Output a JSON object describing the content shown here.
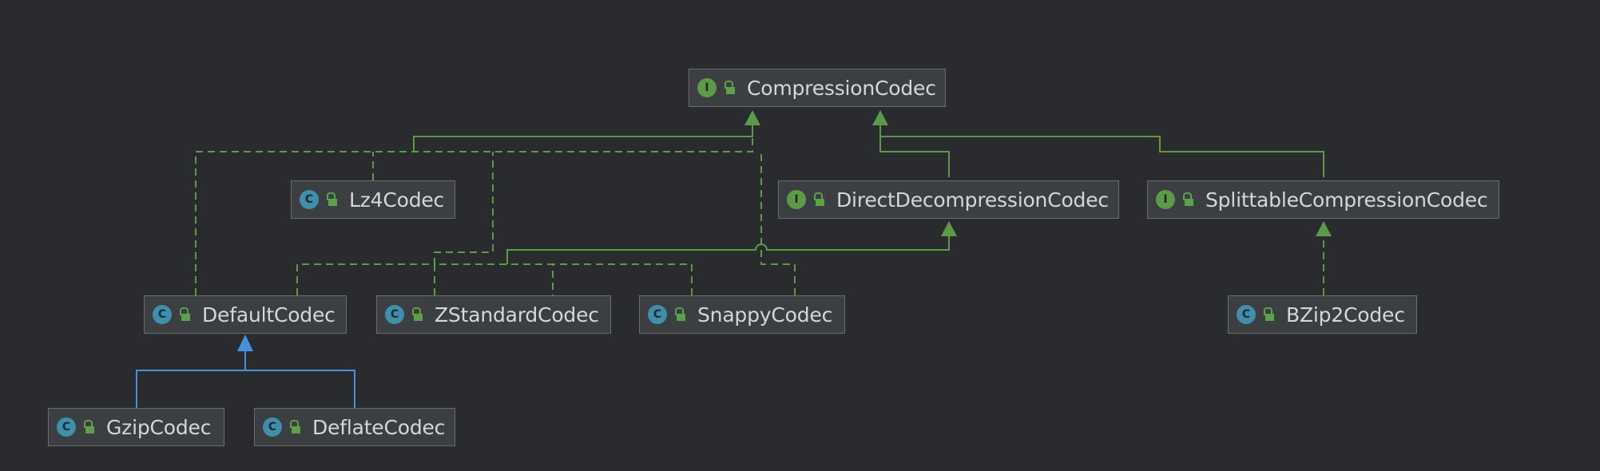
{
  "diagram": {
    "nodes": [
      {
        "id": "compression-codec",
        "kind": "I",
        "label": "CompressionCodec"
      },
      {
        "id": "lz4-codec",
        "kind": "C",
        "label": "Lz4Codec"
      },
      {
        "id": "direct-decompression-codec",
        "kind": "I",
        "label": "DirectDecompressionCodec"
      },
      {
        "id": "splittable-compression-codec",
        "kind": "I",
        "label": "SplittableCompressionCodec"
      },
      {
        "id": "default-codec",
        "kind": "C",
        "label": "DefaultCodec"
      },
      {
        "id": "zstandard-codec",
        "kind": "C",
        "label": "ZStandardCodec"
      },
      {
        "id": "snappy-codec",
        "kind": "C",
        "label": "SnappyCodec"
      },
      {
        "id": "bzip2-codec",
        "kind": "C",
        "label": "BZip2Codec"
      },
      {
        "id": "gzip-codec",
        "kind": "C",
        "label": "GzipCodec"
      },
      {
        "id": "deflate-codec",
        "kind": "C",
        "label": "DeflateCodec"
      }
    ],
    "edges": [
      {
        "from": "direct-decompression-codec",
        "to": "compression-codec",
        "type": "extends-interface"
      },
      {
        "from": "splittable-compression-codec",
        "to": "compression-codec",
        "type": "extends-interface"
      },
      {
        "from": "lz4-codec",
        "to": "compression-codec",
        "type": "implements"
      },
      {
        "from": "default-codec",
        "to": "compression-codec",
        "type": "implements"
      },
      {
        "from": "zstandard-codec",
        "to": "compression-codec",
        "type": "implements"
      },
      {
        "from": "snappy-codec",
        "to": "compression-codec",
        "type": "implements"
      },
      {
        "from": "default-codec",
        "to": "direct-decompression-codec",
        "type": "implements"
      },
      {
        "from": "zstandard-codec",
        "to": "direct-decompression-codec",
        "type": "implements"
      },
      {
        "from": "snappy-codec",
        "to": "direct-decompression-codec",
        "type": "implements"
      },
      {
        "from": "bzip2-codec",
        "to": "splittable-compression-codec",
        "type": "implements"
      },
      {
        "from": "gzip-codec",
        "to": "default-codec",
        "type": "extends"
      },
      {
        "from": "deflate-codec",
        "to": "default-codec",
        "type": "extends"
      }
    ],
    "colors": {
      "background": "#2a2b2f",
      "interface_edge": "#5d9a48",
      "extends_edge": "#4a90d9",
      "class_badge": "#3f8fab",
      "interface_badge": "#5d9a48"
    }
  }
}
